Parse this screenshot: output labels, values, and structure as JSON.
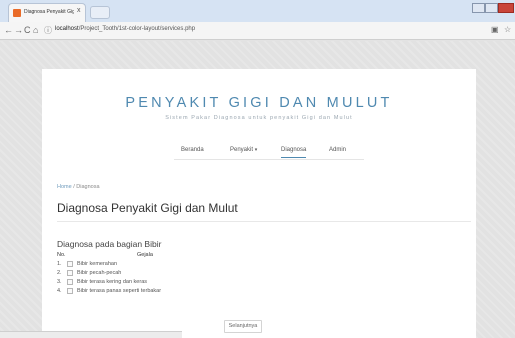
{
  "browser": {
    "tab_title": "Diagnosa Penyakit Gigi dan",
    "tab_close": "x",
    "url_prefix": "localhost",
    "url_path": "/Project_Tooth/1st-color-layout/services.php",
    "back": "←",
    "forward": "→",
    "reload": "C",
    "home": "⌂"
  },
  "site": {
    "title": "PENYAKIT GIGI DAN MULUT",
    "tagline": "Sistem Pakar Diagnosa untuk penyakit Gigi dan Mulut"
  },
  "menu": {
    "items": [
      {
        "label": "Beranda"
      },
      {
        "label": "Penyakit",
        "caret": "▾"
      },
      {
        "label": "Diagnosa"
      },
      {
        "label": "Admin"
      }
    ],
    "active": "Diagnosa"
  },
  "breadcrumb": {
    "home": "Home",
    "separator": "/",
    "current": "Diagnosa"
  },
  "page_heading": "Diagnosa Penyakit Gigi dan Mulut",
  "section": {
    "title": "Diagnosa pada bagian Bibir",
    "col_no": "No.",
    "col_gejala": "Gejala",
    "symptoms": [
      {
        "no": "1.",
        "label": "Bibir kemerahan",
        "checked": false
      },
      {
        "no": "2.",
        "label": "Bibir pecah-pecah",
        "checked": false
      },
      {
        "no": "3.",
        "label": "Bibir terasa kering dan keras",
        "checked": false
      },
      {
        "no": "4.",
        "label": "Bibir terasa panas seperti terbakar",
        "checked": false
      }
    ]
  },
  "next_button": "Selanjutnya",
  "colors": {
    "accent": "#4f89b0",
    "tab_favicon": "#e96b28"
  }
}
